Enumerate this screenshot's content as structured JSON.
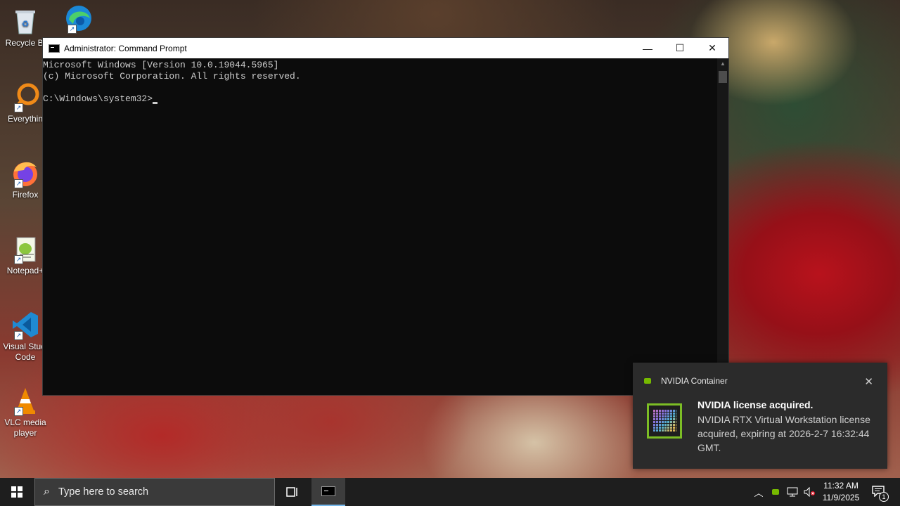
{
  "desktop": {
    "icons": [
      {
        "label": "Recycle Bi",
        "icon": "recycle-bin-icon"
      },
      {
        "label": "",
        "icon": "edge-icon"
      },
      {
        "label": "Everythin",
        "icon": "everything-search-icon"
      },
      {
        "label": "Firefox",
        "icon": "firefox-icon"
      },
      {
        "label": "Notepad+",
        "icon": "notepad-plus-plus-icon"
      },
      {
        "label": "Visual Studi Code",
        "icon": "vscode-icon"
      },
      {
        "label": "VLC media player",
        "icon": "vlc-icon"
      }
    ]
  },
  "cmd_window": {
    "title": "Administrator: Command Prompt",
    "minimize": "—",
    "maximize": "☐",
    "close": "✕",
    "lines": [
      "Microsoft Windows [Version 10.0.19044.5965]",
      "(c) Microsoft Corporation. All rights reserved.",
      "",
      "C:\\Windows\\system32>"
    ]
  },
  "notification": {
    "app": "NVIDIA Container",
    "title": "NVIDIA license acquired.",
    "body": "NVIDIA RTX Virtual Workstation license acquired, expiring at 2026-2-7 16:32:44 GMT.",
    "close": "✕",
    "accent": "#76b900"
  },
  "taskbar": {
    "search_placeholder": "Type here to search",
    "time": "11:32 AM",
    "date": "11/9/2025",
    "notification_count": "1"
  }
}
